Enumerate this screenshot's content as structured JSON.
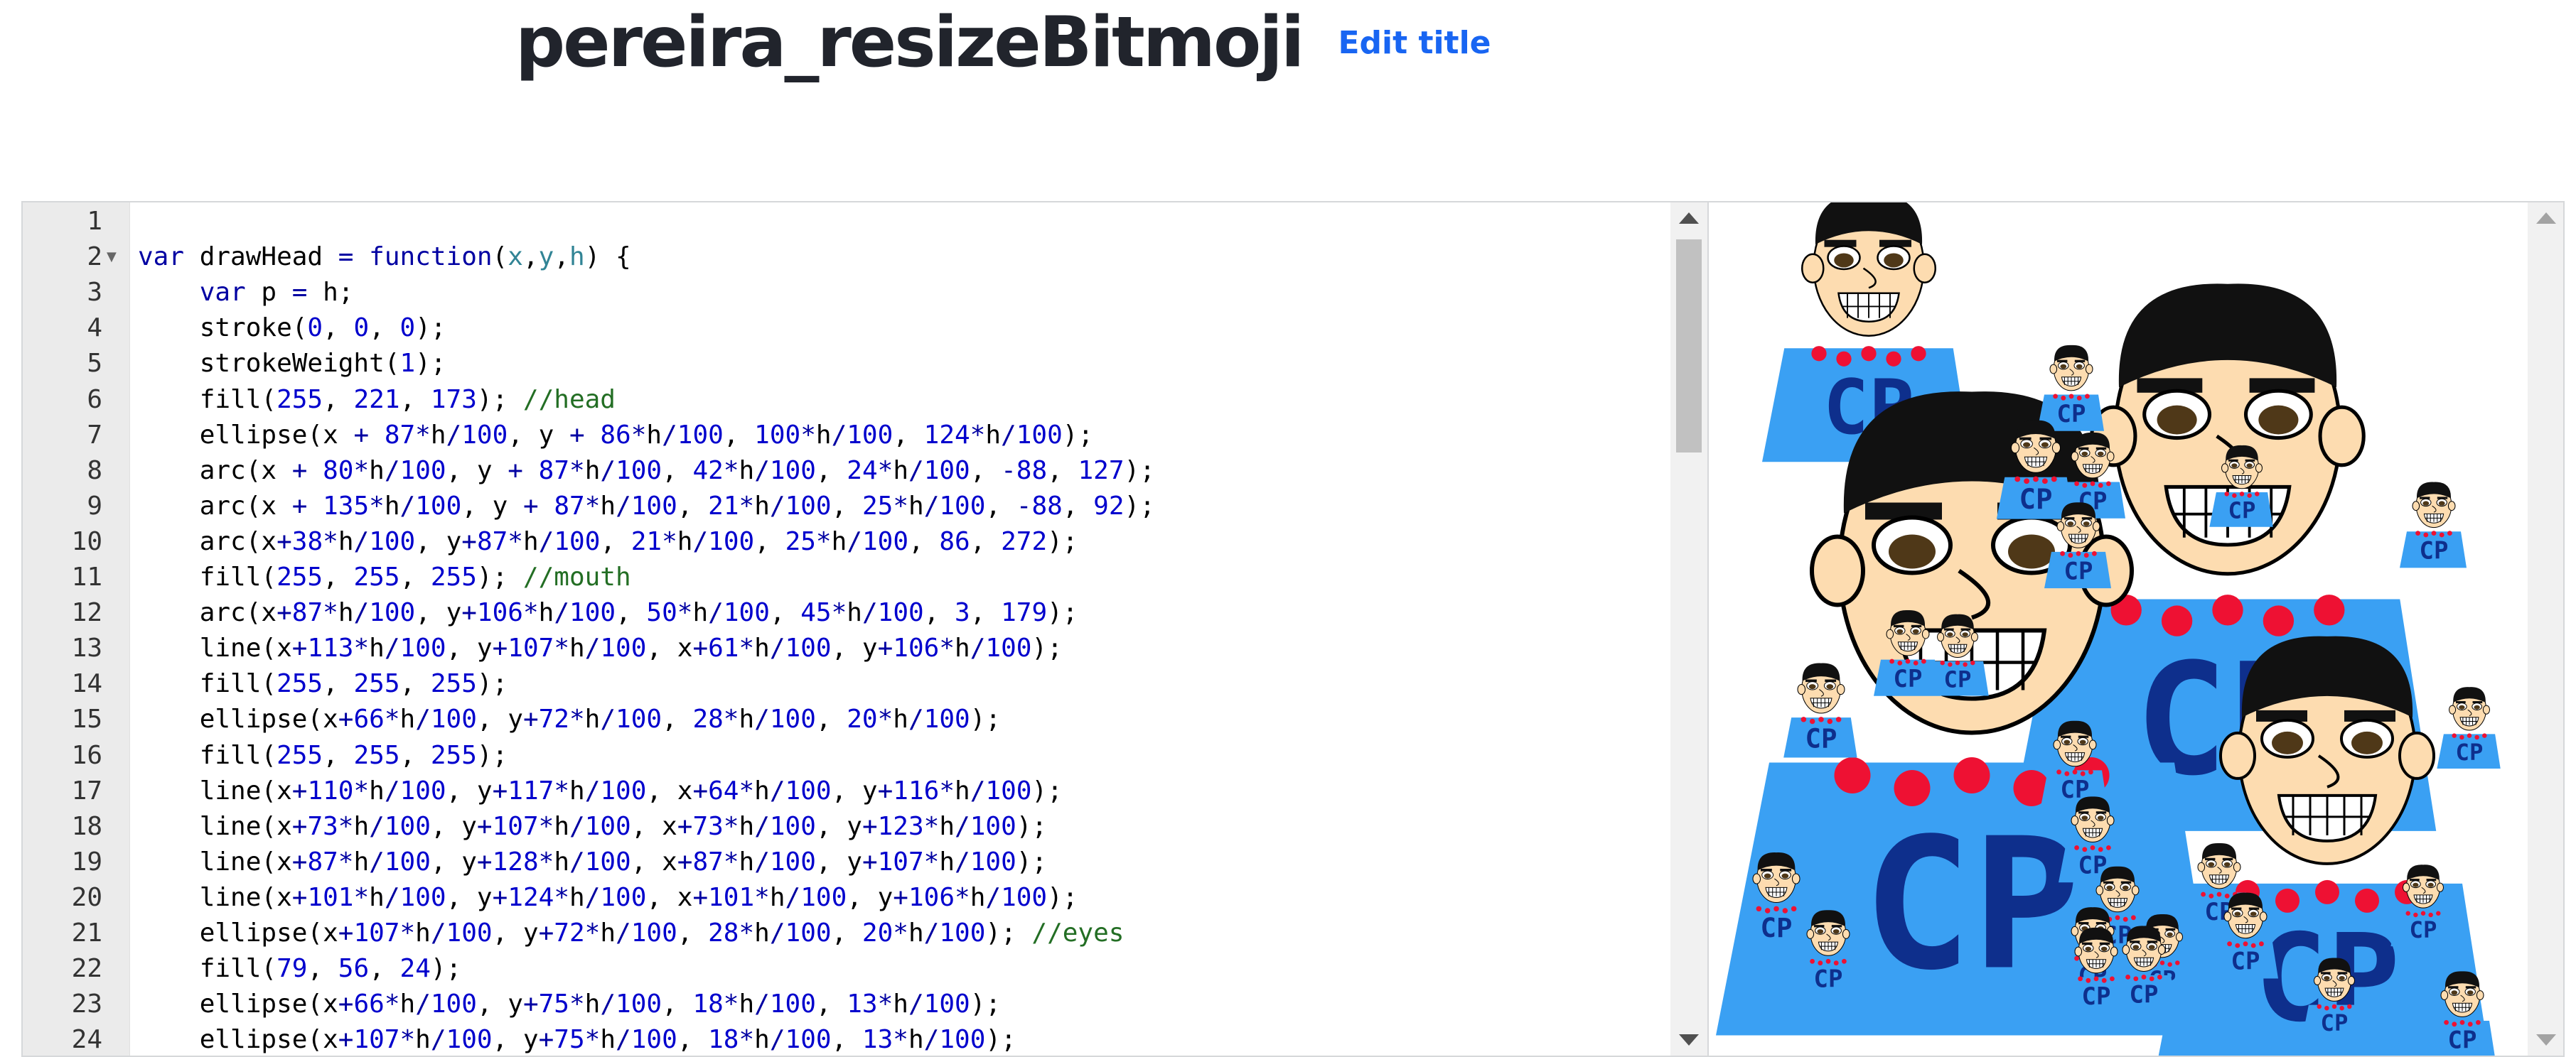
{
  "header": {
    "title": "pereira_resizeBitmoji",
    "edit_title_label": "Edit title"
  },
  "editor": {
    "line_numbers": [
      "1",
      "2",
      "3",
      "4",
      "5",
      "6",
      "7",
      "8",
      "9",
      "10",
      "11",
      "12",
      "13",
      "14",
      "15",
      "16",
      "17",
      "18",
      "19",
      "20",
      "21",
      "22",
      "23",
      "24"
    ],
    "lines": [
      "",
      "var drawHead = function(x,y,h) {",
      "    var p = h;",
      "    stroke(0, 0, 0);",
      "    strokeWeight(1);",
      "    fill(255, 221, 173); //head",
      "    ellipse(x + 87*h/100, y + 86*h/100, 100*h/100, 124*h/100);",
      "    arc(x + 80*h/100, y + 87*h/100, 42*h/100, 24*h/100, -88, 127);",
      "    arc(x + 135*h/100, y + 87*h/100, 21*h/100, 25*h/100, -88, 92);",
      "    arc(x+38*h/100, y+87*h/100, 21*h/100, 25*h/100, 86, 272);",
      "    fill(255, 255, 255); //mouth",
      "    arc(x+87*h/100, y+106*h/100, 50*h/100, 45*h/100, 3, 179);",
      "    line(x+113*h/100, y+107*h/100, x+61*h/100, y+106*h/100);",
      "    fill(255, 255, 255);",
      "    ellipse(x+66*h/100, y+72*h/100, 28*h/100, 20*h/100);",
      "    fill(255, 255, 255);",
      "    line(x+110*h/100, y+117*h/100, x+64*h/100, y+116*h/100);",
      "    line(x+73*h/100, y+107*h/100, x+73*h/100, y+123*h/100);",
      "    line(x+87*h/100, y+128*h/100, x+87*h/100, y+107*h/100);",
      "    line(x+101*h/100, y+124*h/100, x+101*h/100, y+106*h/100);",
      "    ellipse(x+107*h/100, y+72*h/100, 28*h/100, 20*h/100); //eyes",
      "    fill(79, 56, 24);",
      "    ellipse(x+66*h/100, y+75*h/100, 18*h/100, 13*h/100);",
      "    ellipse(x+107*h/100, y+75*h/100, 18*h/100, 13*h/100);"
    ]
  },
  "canvas": {
    "shirt_letters": "CP",
    "colors": {
      "shirt": "#3aa0f3",
      "skin": "#fddcb0",
      "hair": "#111111",
      "letters": "#0e2f8c",
      "beads": "#ee1133",
      "pupil": "#4f3818",
      "keyword": "#0000a2",
      "number": "#0000cd",
      "comment": "#236e24",
      "param": "#318495",
      "link": "#1865f2"
    },
    "icon_names": [
      "scroll-up-arrow-icon",
      "scroll-down-arrow-icon",
      "fold-arrow-icon"
    ]
  }
}
